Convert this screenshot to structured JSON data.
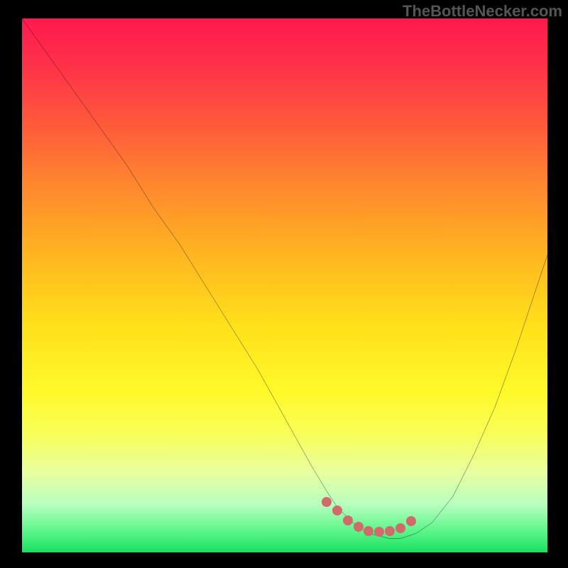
{
  "watermark": "TheBottleNecker.com",
  "chart_data": {
    "type": "line",
    "title": "",
    "xlabel": "",
    "ylabel": "",
    "xlim": [
      0,
      100
    ],
    "ylim": [
      0,
      100
    ],
    "series": [
      {
        "name": "bottleneck-curve",
        "x": [
          0,
          5,
          10,
          15,
          20,
          25,
          30,
          35,
          40,
          45,
          50,
          55,
          58,
          60,
          63,
          66,
          70,
          72,
          75,
          78,
          82,
          86,
          90,
          94,
          98,
          100
        ],
        "y": [
          100,
          93,
          86,
          79,
          72,
          64,
          57,
          49,
          41,
          33,
          24,
          15,
          10,
          7,
          4,
          2,
          1,
          1,
          2,
          4,
          9,
          17,
          26,
          37,
          49,
          55
        ]
      }
    ],
    "highlight_dots": {
      "name": "optimal-range",
      "x": [
        58,
        60,
        62,
        64,
        66,
        68,
        70,
        72,
        74
      ],
      "y": [
        9.5,
        7.8,
        6.0,
        4.8,
        4.0,
        3.8,
        4.0,
        4.5,
        5.8
      ]
    },
    "background": {
      "type": "vertical-gradient",
      "stops": [
        {
          "pos": 0.0,
          "color": "#ff1a4d"
        },
        {
          "pos": 0.45,
          "color": "#ffb81f"
        },
        {
          "pos": 0.7,
          "color": "#fff92a"
        },
        {
          "pos": 1.0,
          "color": "#18e060"
        }
      ]
    }
  }
}
